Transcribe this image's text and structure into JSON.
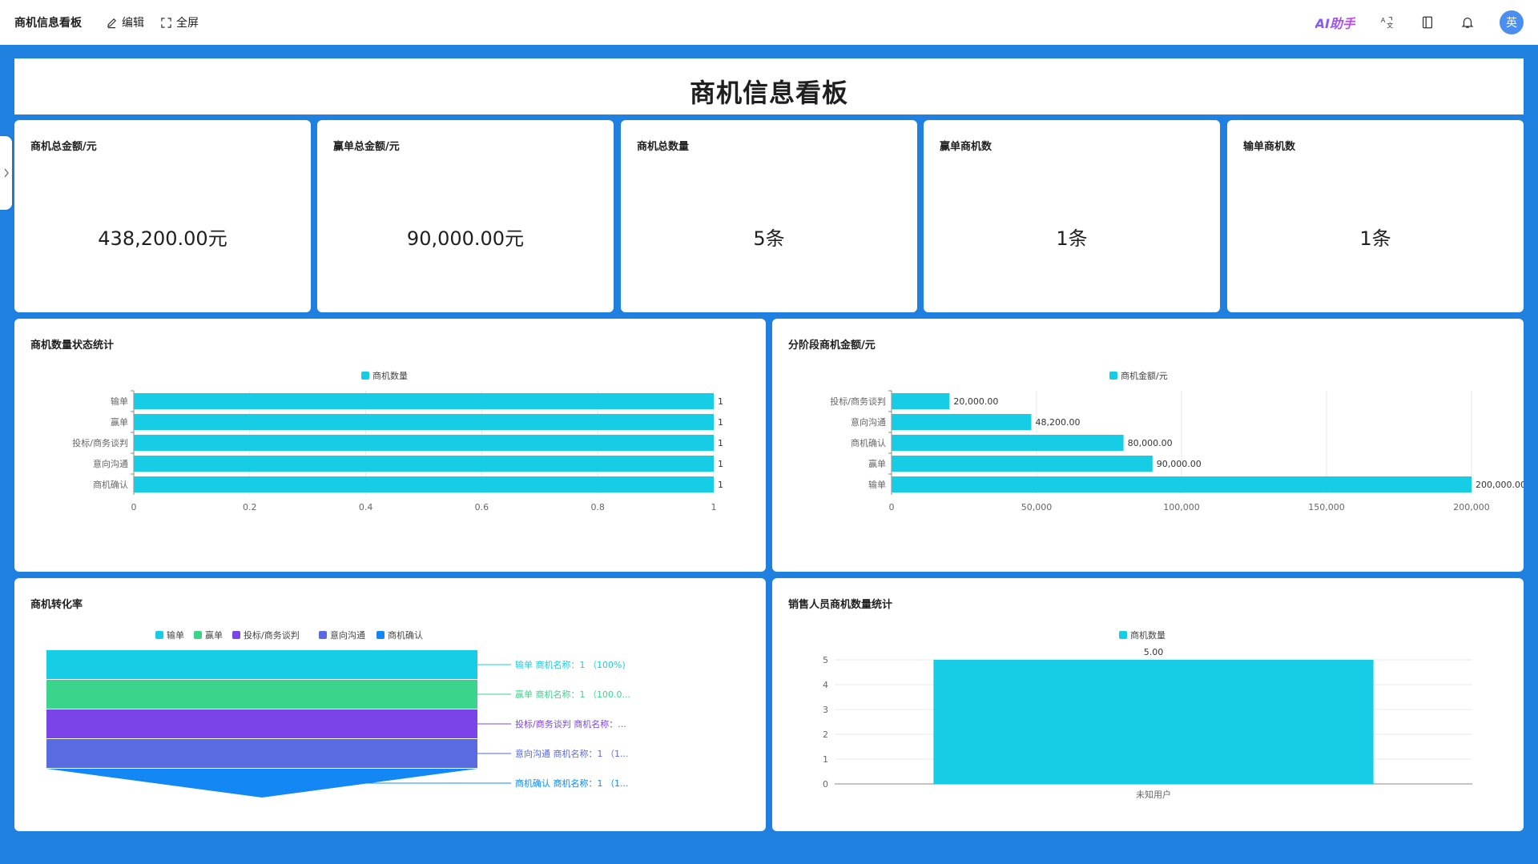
{
  "topbar": {
    "title": "商机信息看板",
    "edit_label": "编辑",
    "fullscreen_label": "全屏",
    "ai_label": "AI助手",
    "avatar_text": "英"
  },
  "page": {
    "title": "商机信息看板"
  },
  "kpis": [
    {
      "label": "商机总金额/元",
      "value": "438,200.00元"
    },
    {
      "label": "赢单总金额/元",
      "value": "90,000.00元"
    },
    {
      "label": "商机总数量",
      "value": "5条"
    },
    {
      "label": "赢单商机数",
      "value": "1条"
    },
    {
      "label": "输单商机数",
      "value": "1条"
    }
  ],
  "panels": {
    "status": {
      "title": "商机数量状态统计"
    },
    "stage": {
      "title": "分阶段商机金额/元"
    },
    "funnel": {
      "title": "商机转化率"
    },
    "sales": {
      "title": "销售人员商机数量统计"
    }
  },
  "colors": {
    "bar": "#17cde6",
    "funnel": [
      "#17cde6",
      "#3ad58b",
      "#7a44e8",
      "#5a6ae0",
      "#1388f5"
    ]
  },
  "chart_data": [
    {
      "type": "bar",
      "orientation": "horizontal",
      "legend": [
        "商机数量"
      ],
      "legend_position": "top-center",
      "categories": [
        "输单",
        "赢单",
        "投标/商务谈判",
        "意向沟通",
        "商机确认"
      ],
      "series": [
        {
          "name": "商机数量",
          "values": [
            1,
            1,
            1,
            1,
            1
          ]
        }
      ],
      "data_labels": [
        "1",
        "1",
        "1",
        "1",
        "1"
      ],
      "xticks": [
        "0",
        "0.2",
        "0.4",
        "0.6",
        "0.8",
        "1"
      ],
      "xlim": [
        0,
        1
      ],
      "grid": true
    },
    {
      "type": "bar",
      "orientation": "horizontal",
      "legend": [
        "商机金额/元"
      ],
      "legend_position": "top-center",
      "categories": [
        "投标/商务谈判",
        "意向沟通",
        "商机确认",
        "赢单",
        "输单"
      ],
      "series": [
        {
          "name": "商机金额/元",
          "values": [
            20000,
            48200,
            80000,
            90000,
            200000
          ]
        }
      ],
      "data_labels": [
        "20,000.00",
        "48,200.00",
        "80,000.00",
        "90,000.00",
        "200,000.00"
      ],
      "xticks": [
        "0",
        "50,000",
        "100,000",
        "150,000",
        "200,000"
      ],
      "xlim": [
        0,
        200000
      ],
      "grid": true
    },
    {
      "type": "funnel",
      "legend": [
        "输单",
        "赢单",
        "投标/商务谈判",
        "意向沟通",
        "商机确认"
      ],
      "legend_position": "top-center",
      "categories": [
        "输单",
        "赢单",
        "投标/商务谈判",
        "意向沟通",
        "商机确认"
      ],
      "values": [
        1,
        1,
        1,
        1,
        1
      ],
      "labels": [
        "输单 商机名称：1 （100%)",
        "赢单 商机名称：1 （100.0...",
        "投标/商务谈判 商机名称：...",
        "意向沟通 商机名称：1 （1...",
        "商机确认 商机名称：1 （1..."
      ]
    },
    {
      "type": "bar",
      "legend": [
        "商机数量"
      ],
      "legend_position": "top-center",
      "categories": [
        "未知用户"
      ],
      "series": [
        {
          "name": "商机数量",
          "values": [
            5
          ]
        }
      ],
      "data_labels": [
        "5.00"
      ],
      "yticks": [
        "0",
        "1",
        "2",
        "3",
        "4",
        "5"
      ],
      "ylim": [
        0,
        5
      ],
      "grid": true
    }
  ]
}
